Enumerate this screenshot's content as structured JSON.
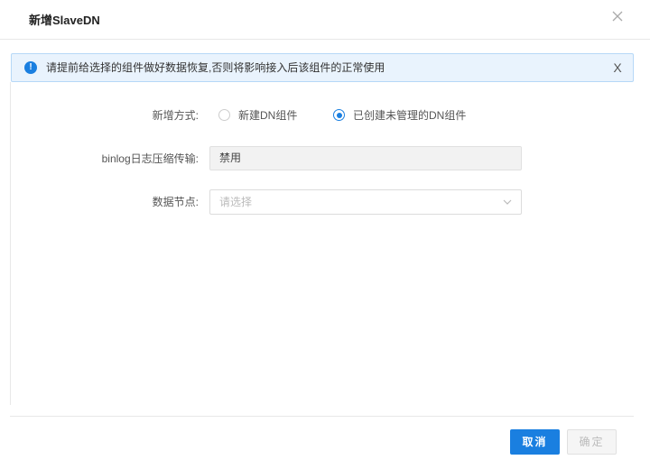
{
  "modal": {
    "title": "新增SlaveDN",
    "close_icon": "close-icon"
  },
  "alert": {
    "icon": "info-icon",
    "icon_glyph": "!",
    "text": "请提前给选择的组件做好数据恢复,否则将影响接入后该组件的正常使用",
    "close_glyph": "X"
  },
  "form": {
    "mode_label": "新增方式:",
    "mode_options": [
      {
        "label": "新建DN组件",
        "checked": false
      },
      {
        "label": "已创建未管理的DN组件",
        "checked": true
      }
    ],
    "binlog_label": "binlog日志压缩传输:",
    "binlog_value": "禁用",
    "node_label": "数据节点:",
    "node_placeholder": "请选择"
  },
  "footer": {
    "cancel_label": "取消",
    "ok_label": "确定"
  },
  "colors": {
    "accent": "#1a7fe0",
    "alert_bg": "#e9f3fd",
    "alert_border": "#b6d8f7"
  }
}
